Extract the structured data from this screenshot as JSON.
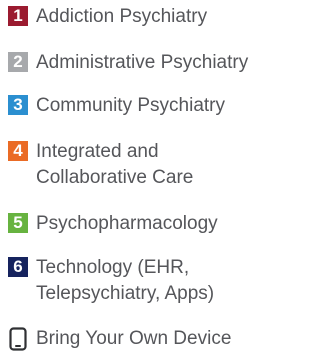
{
  "tracks": [
    {
      "number": "1",
      "label": "Addiction Psychiatry",
      "color": "#9b1b30"
    },
    {
      "number": "2",
      "label": "Administrative Psychiatry",
      "color": "#a7a9ac"
    },
    {
      "number": "3",
      "label": "Community Psychiatry",
      "color": "#2b8fd0"
    },
    {
      "number": "4",
      "label": "Integrated and\nCollaborative Care",
      "color": "#ea6b25"
    },
    {
      "number": "5",
      "label": "Psychopharmacology",
      "color": "#67b340"
    },
    {
      "number": "6",
      "label": "Technology (EHR,\nTelepsychiatry, Apps)",
      "color": "#16235e"
    }
  ],
  "byod": {
    "label": "Bring Your Own Device",
    "icon": "mobile-device-icon"
  }
}
